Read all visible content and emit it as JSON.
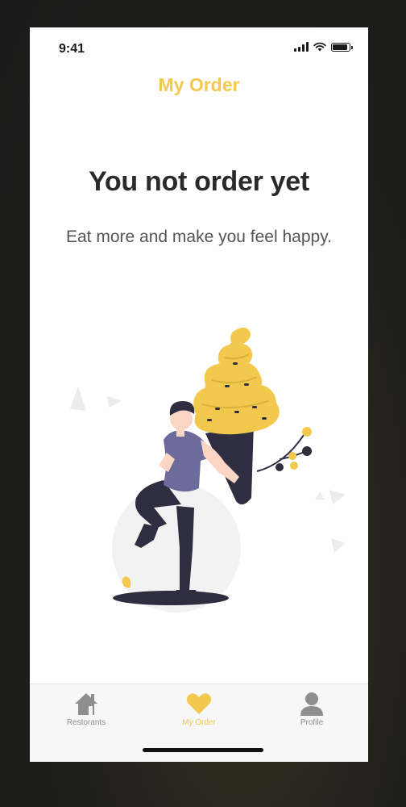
{
  "status_bar": {
    "time": "9:41"
  },
  "header": {
    "title": "My Order"
  },
  "empty_state": {
    "headline": "You not order yet",
    "subtitle": "Eat more and make you feel happy."
  },
  "tab_bar": {
    "items": [
      {
        "label": "Restorants",
        "icon": "home-icon",
        "active": false
      },
      {
        "label": "My Order",
        "icon": "heart-icon",
        "active": true
      },
      {
        "label": "Profile",
        "icon": "user-icon",
        "active": false
      }
    ]
  },
  "colors": {
    "accent": "#f2c94c",
    "text_dark": "#2a2a2a",
    "text_muted": "#555555",
    "tab_inactive": "#8e8e8e",
    "illustration_shirt": "#6c6c9c",
    "illustration_dark": "#2f2e41"
  }
}
